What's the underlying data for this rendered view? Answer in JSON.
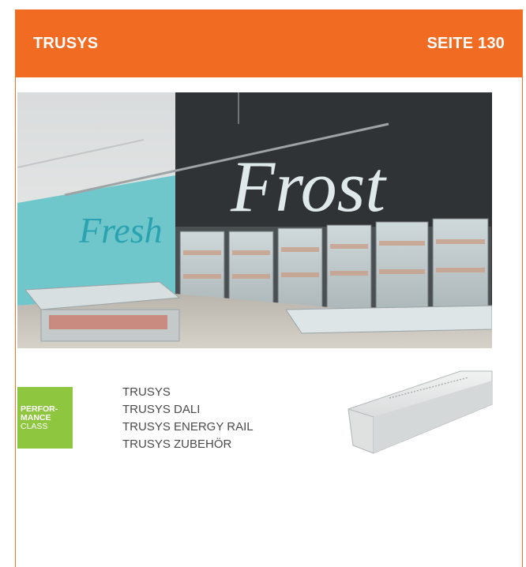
{
  "header": {
    "title": "TRUSYS",
    "page_ref": "SEITE 130"
  },
  "photo": {
    "sign_main": "Frost",
    "sign_side": "Fresh"
  },
  "badge": {
    "line1": "PERFOR-",
    "line2": "MANCE",
    "line3": "CLASS"
  },
  "links": [
    {
      "label": "TRUSYS"
    },
    {
      "label": "TRUSYS DALI"
    },
    {
      "label": "TRUSYS ENERGY RAIL"
    },
    {
      "label": "TRUSYS ZUBEHÖR"
    }
  ],
  "colors": {
    "header_bg": "#f26b22",
    "badge_bg": "#8ec63f",
    "frame": "#f37024"
  }
}
